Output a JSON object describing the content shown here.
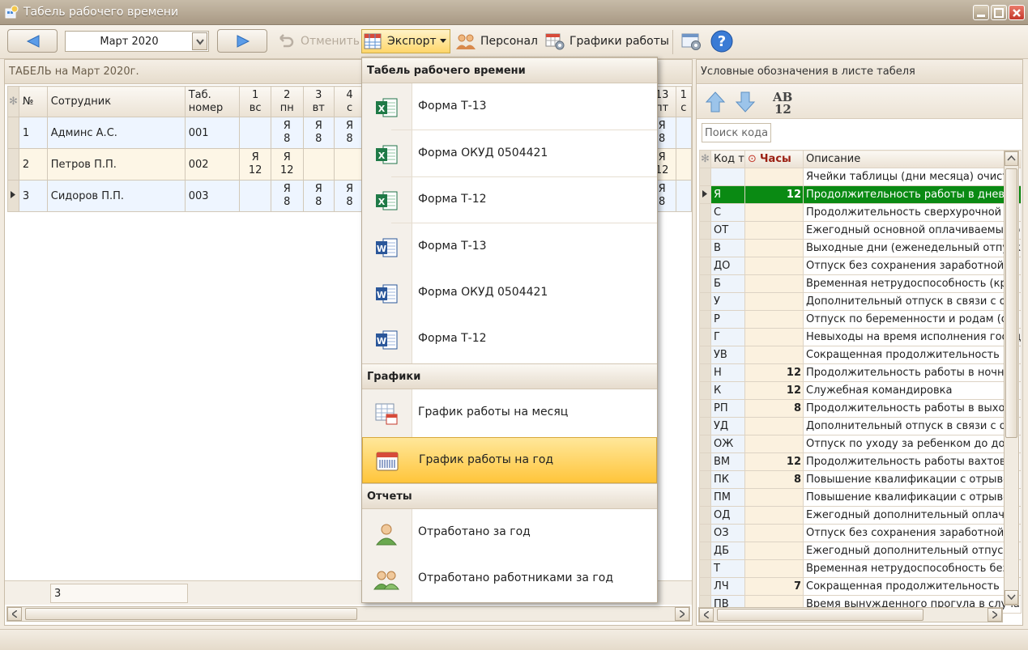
{
  "window": {
    "title": "Табель рабочего времени"
  },
  "toolbar": {
    "month": "Март 2020",
    "undo_label": "Отменить",
    "export_label": "Экспорт",
    "staff_label": "Персонал",
    "schedules_label": "Графики работы"
  },
  "left": {
    "header": "ТАБЕЛЬ на Март 2020г.",
    "columns": {
      "num": "№",
      "employee": "Сотрудник",
      "tab1": "Таб.",
      "tab2": "номер",
      "days": [
        {
          "n": "1",
          "d": "вс"
        },
        {
          "n": "2",
          "d": "пн"
        },
        {
          "n": "3",
          "d": "вт"
        },
        {
          "n": "4",
          "d": "с"
        },
        {
          "n": "13",
          "d": "пт"
        },
        {
          "n": "1",
          "d": "с"
        }
      ]
    },
    "rows": [
      {
        "num": "1",
        "name": "Админс А.С.",
        "tab": "001",
        "cells": [
          [
            "",
            ""
          ],
          [
            "Я",
            "8"
          ],
          [
            "Я",
            "8"
          ],
          [
            "Я",
            "8"
          ],
          [
            "Я",
            "8"
          ],
          [
            "",
            ""
          ]
        ]
      },
      {
        "num": "2",
        "name": "Петров П.П.",
        "tab": "002",
        "cells": [
          [
            "Я",
            "12"
          ],
          [
            "Я",
            "12"
          ],
          [
            "",
            ""
          ],
          [
            "",
            ""
          ],
          [
            "Я",
            "12"
          ],
          [
            "",
            ""
          ]
        ]
      },
      {
        "num": "3",
        "name": "Сидоров П.П.",
        "tab": "003",
        "cells": [
          [
            "",
            ""
          ],
          [
            "Я",
            "8"
          ],
          [
            "Я",
            "8"
          ],
          [
            "Я",
            "8"
          ],
          [
            "Я",
            "8"
          ],
          [
            "",
            ""
          ]
        ]
      }
    ],
    "footer_count": "3"
  },
  "right": {
    "header": "Условные обозначения в листе табеля",
    "search_placeholder": "Поиск кода",
    "columns": {
      "code": "Код т",
      "hours": "Часы",
      "desc": "Описание"
    },
    "rows": [
      {
        "code": "",
        "hours": "",
        "desc": "Ячейки таблицы (дни месяца) очисти"
      },
      {
        "code": "Я",
        "hours": "12",
        "desc": "Продолжительность работы в дневно",
        "selected": true
      },
      {
        "code": "С",
        "hours": "",
        "desc": "Продолжительность сверхурочной ра"
      },
      {
        "code": "ОТ",
        "hours": "",
        "desc": "Ежегодный основной оплачиваемый о"
      },
      {
        "code": "В",
        "hours": "",
        "desc": "Выходные дни (еженедельный отпуск"
      },
      {
        "code": "ДО",
        "hours": "",
        "desc": "Отпуск без сохранения заработной п"
      },
      {
        "code": "Б",
        "hours": "",
        "desc": "Временная нетрудоспособность (кро"
      },
      {
        "code": "У",
        "hours": "",
        "desc": "Дополнительный отпуск в связи с об"
      },
      {
        "code": "Р",
        "hours": "",
        "desc": "Отпуск по беременности и родам (от"
      },
      {
        "code": "Г",
        "hours": "",
        "desc": "Невыходы на время исполнения госуд"
      },
      {
        "code": "УВ",
        "hours": "",
        "desc": "Сокращенная продолжительность ра"
      },
      {
        "code": "Н",
        "hours": "12",
        "desc": "Продолжительность работы в ночно"
      },
      {
        "code": "К",
        "hours": "12",
        "desc": "Служебная командировка"
      },
      {
        "code": "РП",
        "hours": "8",
        "desc": "Продолжительность работы в выход"
      },
      {
        "code": "УД",
        "hours": "",
        "desc": "Дополнительный отпуск в связи с об"
      },
      {
        "code": "ОЖ",
        "hours": "",
        "desc": "Отпуск по уходу за ребенком до дост"
      },
      {
        "code": "ВМ",
        "hours": "12",
        "desc": "Продолжительность работы вахтово"
      },
      {
        "code": "ПК",
        "hours": "8",
        "desc": "Повышение квалификации с отрывом"
      },
      {
        "code": "ПМ",
        "hours": "",
        "desc": "Повышение квалификации с отрывом"
      },
      {
        "code": "ОД",
        "hours": "",
        "desc": "Ежегодный дополнительный оплачив"
      },
      {
        "code": "ОЗ",
        "hours": "",
        "desc": "Отпуск без сохранения заработной п"
      },
      {
        "code": "ДБ",
        "hours": "",
        "desc": "Ежегодный дополнительный отпуск б"
      },
      {
        "code": "Т",
        "hours": "",
        "desc": "Временная нетрудоспособность без н"
      },
      {
        "code": "ЛЧ",
        "hours": "7",
        "desc": "Сокращенная продолжительность ра"
      },
      {
        "code": "ПВ",
        "hours": "",
        "desc": "Время вынужденного прогула в случа"
      }
    ]
  },
  "menu": {
    "sections": {
      "timesheet": "Табель рабочего времени",
      "schedules": "Графики",
      "reports": "Отчеты"
    },
    "items": [
      {
        "label": "Форма Т-13",
        "icon": "excel-icon"
      },
      {
        "label": "Форма ОКУД 0504421",
        "icon": "excel-icon"
      },
      {
        "label": "Форма Т-12",
        "icon": "excel-icon"
      },
      {
        "label": "Форма Т-13",
        "icon": "word-icon"
      },
      {
        "label": "Форма ОКУД 0504421",
        "icon": "word-icon"
      },
      {
        "label": "Форма Т-12",
        "icon": "word-icon"
      },
      {
        "label": "График работы на месяц",
        "icon": "calendar-month-icon"
      },
      {
        "label": "График работы на год",
        "icon": "calendar-year-icon"
      },
      {
        "label": "Отработано за год",
        "icon": "person-icon"
      },
      {
        "label": "Отработано работниками за год",
        "icon": "people-icon"
      }
    ]
  },
  "colors": {
    "selected_row": "#0a8a13",
    "highlight": "#ffc53b",
    "accent": "#3a7bd5"
  }
}
